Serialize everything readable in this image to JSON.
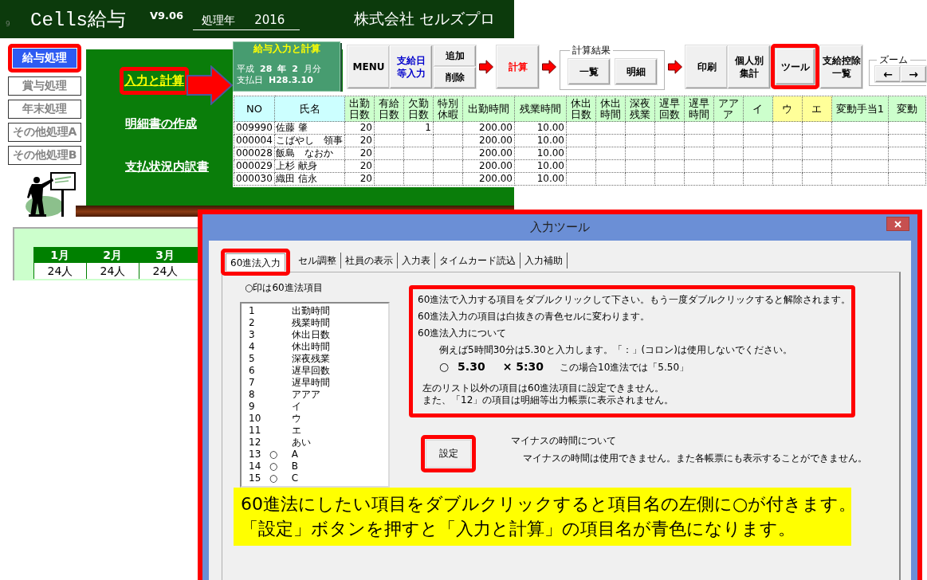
{
  "header": {
    "corner_label": "9",
    "logo": "Cells給与",
    "version": "V9.06",
    "year_label": "処理年",
    "year": "2016",
    "company": "株式会社 セルズプロ"
  },
  "sidebar": {
    "items": [
      {
        "label": "給与処理",
        "selected": true,
        "highlighted": true
      },
      {
        "label": "賞与処理",
        "selected": false,
        "highlighted": false
      },
      {
        "label": "年末処理",
        "selected": false,
        "highlighted": false
      },
      {
        "label": "その他処理A",
        "selected": false,
        "highlighted": false
      },
      {
        "label": "その他処理B",
        "selected": false,
        "highlighted": false
      }
    ]
  },
  "menu_panel": {
    "links": [
      {
        "label": "入力と計算",
        "selected": true,
        "highlighted": true
      },
      {
        "label": "明細書の作成",
        "selected": false,
        "highlighted": false
      },
      {
        "label": "支払状況内訳書",
        "selected": false,
        "highlighted": false
      }
    ]
  },
  "period_card": {
    "title": "給与入力と計算",
    "era": "平成",
    "year": "28",
    "year_unit": "年",
    "month": "2",
    "month_unit": "月分",
    "pay_date_label": "支払日",
    "pay_date": "H28.3.10"
  },
  "toolbar": [
    {
      "kind": "button",
      "lines": [
        "MENU"
      ],
      "color": "#000000",
      "highlighted": false
    },
    {
      "kind": "button",
      "lines": [
        "支給日",
        "等入力"
      ],
      "color": "#0000cc",
      "highlighted": false
    },
    {
      "kind": "stack",
      "buttons": [
        "追加",
        "削除"
      ]
    },
    {
      "kind": "arrow"
    },
    {
      "kind": "button",
      "lines": [
        "計算"
      ],
      "color": "#ff0000",
      "highlighted": false
    },
    {
      "kind": "arrow"
    },
    {
      "kind": "group",
      "title": "計算結果",
      "buttons": [
        "一覧",
        "明細"
      ]
    },
    {
      "kind": "arrow"
    },
    {
      "kind": "button",
      "lines": [
        "印刷"
      ],
      "color": "#000000",
      "highlighted": false
    },
    {
      "kind": "button",
      "lines": [
        "個人別",
        "集計"
      ],
      "color": "#000000",
      "highlighted": false
    },
    {
      "kind": "button",
      "lines": [
        "ツール"
      ],
      "color": "#000000",
      "highlighted": true
    },
    {
      "kind": "button",
      "lines": [
        "支給控除",
        "一覧"
      ],
      "color": "#000000",
      "highlighted": false
    },
    {
      "kind": "zoom",
      "title": "ズーム",
      "buttons": [
        "←",
        "→"
      ]
    }
  ],
  "table": {
    "columns": [
      {
        "label": "NO",
        "kind": "code",
        "color": "#ccffff"
      },
      {
        "label": "氏名",
        "kind": "name",
        "color": "#ccffff"
      },
      {
        "label": "出勤日数",
        "kind": "count",
        "color": "#ccffcc"
      },
      {
        "label": "有給日数",
        "kind": "count",
        "color": "#ccffcc"
      },
      {
        "label": "欠勤日数",
        "kind": "count",
        "color": "#ccffcc"
      },
      {
        "label": "特別休暇",
        "kind": "count",
        "color": "#ccffcc"
      },
      {
        "label": "出勤時間",
        "kind": "time",
        "color": "#ccffcc"
      },
      {
        "label": "残業時間",
        "kind": "time",
        "color": "#ccffcc"
      },
      {
        "label": "休出日数",
        "kind": "count",
        "color": "#ccffcc"
      },
      {
        "label": "休出時間",
        "kind": "count",
        "color": "#ccffcc"
      },
      {
        "label": "深夜残業",
        "kind": "count",
        "color": "#ccffcc"
      },
      {
        "label": "遅早回数",
        "kind": "count",
        "color": "#ccffcc"
      },
      {
        "label": "遅早時間",
        "kind": "count",
        "color": "#ccffcc"
      },
      {
        "label": "アアア",
        "kind": "count",
        "color": "#ccffcc"
      },
      {
        "label": "イ",
        "kind": "count",
        "color": "#ccffcc"
      },
      {
        "label": "ウ",
        "kind": "count",
        "color": "#ffff99"
      },
      {
        "label": "エ",
        "kind": "count",
        "color": "#ffff99"
      },
      {
        "label": "変動手当1",
        "kind": "allowance",
        "color": "#ccffcc"
      },
      {
        "label": "変動",
        "kind": "allowance",
        "color": "#ccffcc"
      }
    ],
    "rows": [
      {
        "no": "009990",
        "name": "佐藤 肇",
        "work_days": "20",
        "absence_days": "1",
        "work_hours": "200.00",
        "overtime_hours": "10.00"
      },
      {
        "no": "000004",
        "name": "こばやし　領事",
        "work_days": "20",
        "work_hours": "200.00",
        "overtime_hours": "10.00"
      },
      {
        "no": "000028",
        "name": "飯島　なおか",
        "work_days": "20",
        "work_hours": "200.00",
        "overtime_hours": "10.00"
      },
      {
        "no": "000029",
        "name": "上杉 献身",
        "work_days": "20",
        "work_hours": "200.00",
        "overtime_hours": "10.00"
      },
      {
        "no": "000030",
        "name": "織田 信永",
        "work_days": "20",
        "work_hours": "200.00",
        "overtime_hours": "10.00"
      }
    ]
  },
  "summary": {
    "columns": [
      {
        "month": "1月",
        "count": "24人"
      },
      {
        "month": "2月",
        "count": "24人"
      },
      {
        "month": "3月",
        "count": "24人"
      }
    ]
  },
  "dialog": {
    "title": "入力ツール",
    "highlighted": true,
    "tabs": [
      {
        "label": "60進法入力",
        "selected": true,
        "highlighted": true
      },
      {
        "label": "セル調整",
        "selected": false,
        "highlighted": false
      },
      {
        "label": "社員の表示",
        "selected": false,
        "highlighted": false
      },
      {
        "label": "入力表",
        "selected": false,
        "highlighted": false
      },
      {
        "label": "タイムカード読込",
        "selected": false,
        "highlighted": false
      },
      {
        "label": "入力補助",
        "selected": false,
        "highlighted": false
      }
    ],
    "list_caption": "○印は60進法項目",
    "list_items": [
      {
        "number": "1",
        "name": "出勤時間"
      },
      {
        "number": "2",
        "name": "残業時間"
      },
      {
        "number": "3",
        "name": "休出日数"
      },
      {
        "number": "4",
        "name": "休出時間"
      },
      {
        "number": "5",
        "name": "深夜残業"
      },
      {
        "number": "6",
        "name": "遅早回数"
      },
      {
        "number": "7",
        "name": "遅早時間"
      },
      {
        "number": "8",
        "name": "アアア"
      },
      {
        "number": "9",
        "name": "イ"
      },
      {
        "number": "10",
        "name": "ウ"
      },
      {
        "number": "11",
        "name": "エ"
      },
      {
        "number": "12",
        "name": "あい"
      },
      {
        "number": "13",
        "mark": "○",
        "name": "A"
      },
      {
        "number": "14",
        "mark": "○",
        "name": "B"
      },
      {
        "number": "15",
        "mark": "○",
        "name": "C"
      }
    ],
    "info_box": {
      "highlighted": true,
      "lines": [
        "60進法で入力する項目をダブルクリックして下さい。もう一度ダブルクリックすると解除されます。",
        "60進法入力の項目は白抜きの青色セルに変わります。",
        "60進法入力について"
      ],
      "example_intro": "例えば5時間30分は5.30と入力します。「：」(コロン)は使用しないでください。",
      "example": {
        "correct": "○ 5.30",
        "wrong": "× 5:30",
        "note": "この場合10進法では「5.50」"
      },
      "notes": [
        "左のリスト以外の項目は60進法項目に設定できません。",
        "また、「12」の項目は明細等出力帳票に表示されません。"
      ]
    },
    "set_button": {
      "label": "設定",
      "highlighted": true
    },
    "minus_section": {
      "title": "マイナスの時間について",
      "text": "マイナスの時間は使用できません。また各帳票にも表示することができません。"
    },
    "callout": {
      "lines": [
        "60進法にしたい項目をダブルクリックすると項目名の左側に○が付きます。",
        "「設定」ボタンを押すと「入力と計算」の項目名が青色になります。"
      ]
    }
  }
}
